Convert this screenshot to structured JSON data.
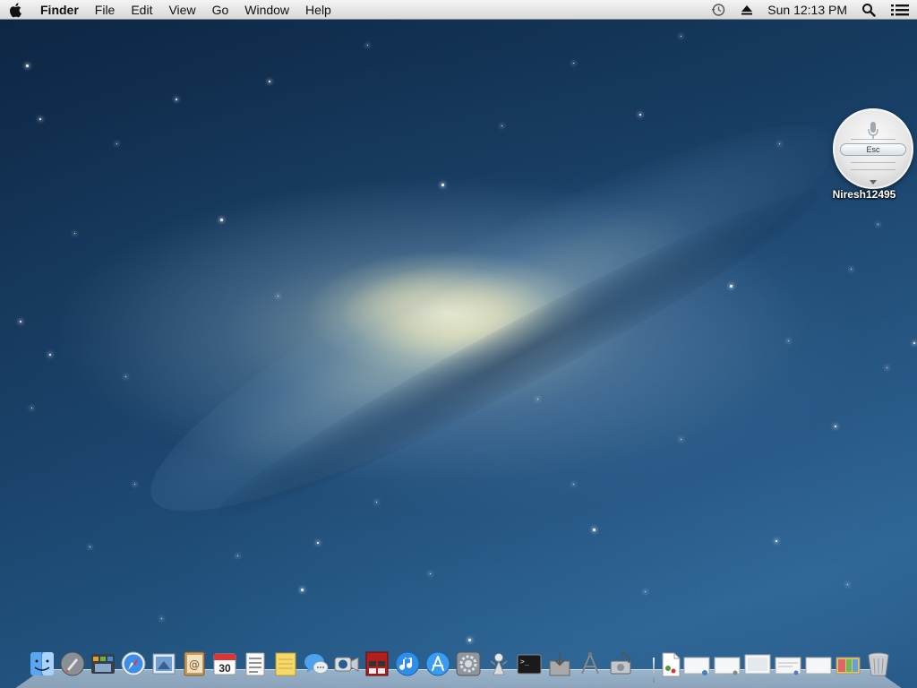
{
  "menubar": {
    "app_name": "Finder",
    "menus": [
      "File",
      "Edit",
      "View",
      "Go",
      "Window"
    ],
    "help": "Help",
    "clock": "Sun 12:13 PM"
  },
  "widget": {
    "esc_label": "Esc",
    "username": "Niresh12495"
  },
  "dock": {
    "items": [
      "finder-icon",
      "launchpad-icon",
      "mission-control-icon",
      "safari-icon",
      "mail-icon",
      "contacts-icon",
      "calendar-icon",
      "reminders-icon",
      "notes-icon",
      "messages-icon",
      "facetime-icon",
      "photo-booth-icon",
      "itunes-icon",
      "app-store-icon",
      "system-preferences-icon",
      "automator-icon",
      "terminal-icon",
      "installer-icon",
      "network-icon",
      "disk-utility-icon",
      "document-icon",
      "stack-icon",
      "trash-icon"
    ],
    "calendar_day": "30",
    "terminal_prompt": ">_"
  },
  "colors": {
    "accent": "#1f6fd1",
    "menubar": "#e8e8e8",
    "wallpaper_dark": "#0d2542",
    "wallpaper_light": "#2a6290"
  }
}
